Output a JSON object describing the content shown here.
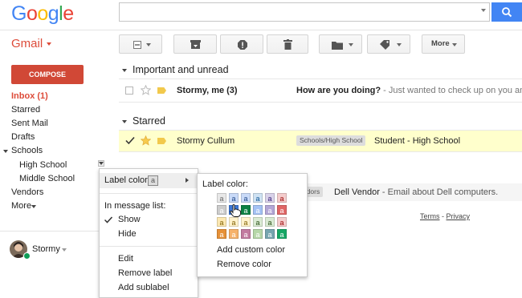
{
  "header": {
    "logo_letters": [
      {
        "ch": "G",
        "color": "#4285f4"
      },
      {
        "ch": "o",
        "color": "#ea4335"
      },
      {
        "ch": "o",
        "color": "#fbbc05"
      },
      {
        "ch": "g",
        "color": "#4285f4"
      },
      {
        "ch": "l",
        "color": "#34a853"
      },
      {
        "ch": "e",
        "color": "#ea4335"
      }
    ],
    "search_value": "",
    "app_label": "Gmail"
  },
  "toolbar": {
    "more_label": "More"
  },
  "sidebar": {
    "compose_label": "COMPOSE",
    "items": [
      {
        "label": "Inbox (1)"
      },
      {
        "label": "Starred"
      },
      {
        "label": "Sent Mail"
      },
      {
        "label": "Drafts"
      },
      {
        "label": "Schools"
      },
      {
        "label": "High School"
      },
      {
        "label": "Middle School"
      },
      {
        "label": "Vendors"
      },
      {
        "label": "More"
      }
    ],
    "user_name": "Stormy"
  },
  "sections": {
    "important_title": "Important and unread",
    "starred_title": "Starred"
  },
  "emails": [
    {
      "sender": "Stormy, me (3)",
      "subject": "How are you doing?",
      "snippet": " - Just wanted to check up on you and say"
    },
    {
      "sender": "Stormy Cullum",
      "label_chip": "Schools/High School",
      "subject": "Student - High School"
    },
    {
      "label_chip": "Vendors",
      "sender": "Dell Vendor",
      "snippet": " - Email about Dell computers."
    }
  ],
  "footer": {
    "terms": "Terms",
    "dash": " - ",
    "privacy": "Privacy"
  },
  "label_menu": {
    "label_color": "Label color",
    "label_color_sample": "a",
    "in_message_list": "In message list:",
    "show": "Show",
    "hide": "Hide",
    "edit": "Edit",
    "remove_label": "Remove label",
    "add_sublabel": "Add sublabel"
  },
  "color_menu": {
    "title": "Label color:",
    "swatch_letter": "a",
    "add_custom": "Add custom color",
    "remove": "Remove color",
    "swatches": [
      [
        {
          "bg": "#e8e8e8",
          "fg": "#666"
        },
        {
          "bg": "#c9daf8",
          "fg": "#1c4587"
        },
        {
          "bg": "#c9daf8",
          "fg": "#1c4587"
        },
        {
          "bg": "#cfe2f3",
          "fg": "#0b5394"
        },
        {
          "bg": "#d9d2e9",
          "fg": "#351c75"
        },
        {
          "bg": "#f4cccc",
          "fg": "#990000"
        }
      ],
      [
        {
          "bg": "#cccccc",
          "fg": "#fff"
        },
        {
          "bg": "#3c78d8",
          "fg": "#fff"
        },
        {
          "bg": "#0b8043",
          "fg": "#fff"
        },
        {
          "bg": "#a4c2f4",
          "fg": "#fff"
        },
        {
          "bg": "#b4a7d6",
          "fg": "#fff"
        },
        {
          "bg": "#e06666",
          "fg": "#fff"
        }
      ],
      [
        {
          "bg": "#fce8b2",
          "fg": "#7f6000"
        },
        {
          "bg": "#fff2cc",
          "fg": "#7f6000"
        },
        {
          "bg": "#fff2cc",
          "fg": "#7f6000"
        },
        {
          "bg": "#d9ead3",
          "fg": "#274e13"
        },
        {
          "bg": "#d9ead3",
          "fg": "#274e13"
        },
        {
          "bg": "#f4cccc",
          "fg": "#990000"
        }
      ],
      [
        {
          "bg": "#e69138",
          "fg": "#fff"
        },
        {
          "bg": "#f6b26b",
          "fg": "#fff"
        },
        {
          "bg": "#c27ba0",
          "fg": "#fff"
        },
        {
          "bg": "#b6d7a8",
          "fg": "#fff"
        },
        {
          "bg": "#76a5af",
          "fg": "#fff"
        },
        {
          "bg": "#16a765",
          "fg": "#fff"
        }
      ]
    ]
  }
}
